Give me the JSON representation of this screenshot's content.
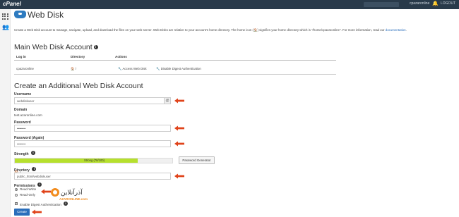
{
  "topbar": {
    "logo": "cPanel",
    "user": "cpazaronline",
    "logout": "LOGOUT"
  },
  "page": {
    "title": "Web Disk",
    "intro": "Create a Web Disk account to manage, navigate, upload, and download the files on your web server. Web Disks are relative to your account's home directory. The home icon (🏠) signifies your home directory which is \"/home/cpazaronline\". For more information, read our",
    "intro_link": "documentation"
  },
  "main_account": {
    "heading": "Main Web Disk Account",
    "columns": [
      "Log in",
      "Directory",
      "Actions"
    ],
    "row": {
      "login": "cpazaronline",
      "directory": "/",
      "action1": "Access Web Disk",
      "action2": "Disable Digest Authentication"
    }
  },
  "form": {
    "heading": "Create an Additional Web Disk Account",
    "username_label": "Username",
    "username_value": "webdiskuser",
    "domain_label": "Domain",
    "domain_value": "test.azaronline.com",
    "password_label": "Password",
    "password_value": "••••••••",
    "password_again_label": "Password (Again)",
    "password_again_value": "••••••••",
    "strength_label": "Strength",
    "strength_text": "Strong (78/100)",
    "strength_value": 0.78,
    "password_generator": "Password Generator",
    "directory_label": "Directory",
    "directory_prefix": "/",
    "directory_value": "public_html/webdiskuser",
    "permissions_label": "Permissions",
    "perm_rw": "Read-Write",
    "perm_ro": "Read-Only",
    "digest_label": "Enable Digest Authentication",
    "create_button": "Create"
  },
  "watermark": {
    "text": "آذرآنلاین",
    "sub": "AZARONLINE.com"
  },
  "colors": {
    "accent": "#2a6ebb",
    "topbar": "#293a4a",
    "strength": "#b6e02d",
    "arrow": "#e0431a"
  }
}
